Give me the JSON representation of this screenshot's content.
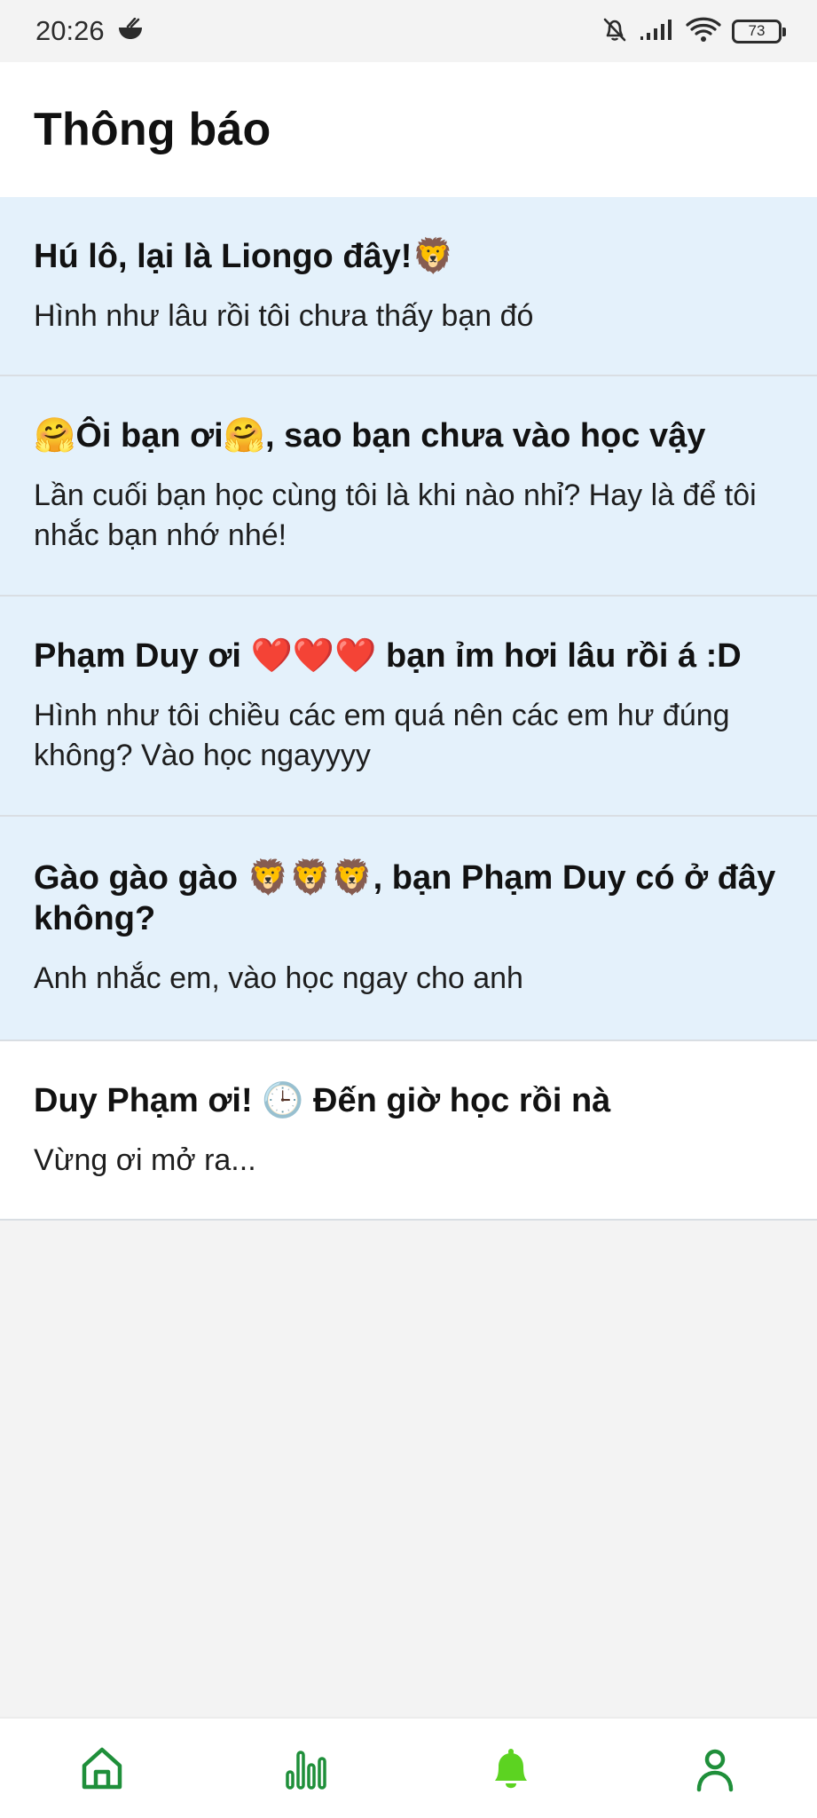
{
  "status_bar": {
    "time": "20:26",
    "battery": "73",
    "icons": [
      "ramen-icon",
      "bell-off-icon",
      "signal-icon",
      "wifi-icon",
      "battery-icon"
    ]
  },
  "header": {
    "title": "Thông báo"
  },
  "notifications": [
    {
      "title": "Hú lô, lại là Liongo đây!🦁",
      "body": "Hình như lâu rồi tôi chưa thấy bạn đó",
      "state": "unread"
    },
    {
      "title": "🤗Ôi bạn ơi🤗, sao bạn chưa vào học vậy",
      "body": "Lần cuối bạn học cùng tôi là khi nào nhỉ? Hay là để tôi nhắc bạn nhớ nhé!",
      "state": "unread"
    },
    {
      "title": "Phạm Duy ơi ❤️❤️❤️ bạn ỉm hơi lâu rồi á :D",
      "body": "Hình như tôi chiều các em quá nên các em hư đúng không? Vào học ngayyyy",
      "state": "unread"
    },
    {
      "title": "Gào gào gào 🦁🦁🦁, bạn Phạm Duy có ở đây không?",
      "body": "Anh nhắc em, vào học ngay cho anh",
      "state": "unread"
    },
    {
      "title": "Duy Phạm ơi! 🕒 Đến giờ học rồi nà",
      "body": "Vừng ơi mở ra...",
      "state": "read"
    }
  ],
  "bottom_nav": {
    "items": [
      {
        "icon": "home-icon",
        "active": false
      },
      {
        "icon": "stats-icon",
        "active": false
      },
      {
        "icon": "bell-icon",
        "active": true
      },
      {
        "icon": "profile-icon",
        "active": false
      }
    ],
    "colors": {
      "inactive": "#1f8f3a",
      "active": "#5cd321"
    }
  },
  "colors": {
    "unread_bg": "#e4f1fb",
    "read_bg": "#ffffff",
    "page_bg": "#f3f3f3"
  }
}
